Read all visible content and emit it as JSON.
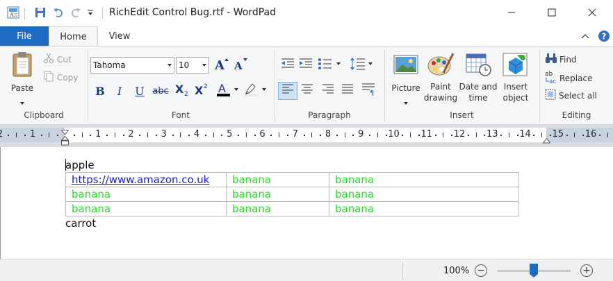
{
  "window": {
    "title": "RichEdit Control Bug.rtf - WordPad",
    "controls": [
      "minimize-icon",
      "maximize-icon",
      "close-icon"
    ]
  },
  "quick_access": [
    "save-icon",
    "undo-icon",
    "redo-icon",
    "customize-dropdown-icon"
  ],
  "ribbon": {
    "tabs": {
      "file": "File",
      "home": "Home",
      "view": "View"
    },
    "clipboard": {
      "label": "Clipboard",
      "paste": "Paste",
      "cut": "Cut",
      "copy": "Copy"
    },
    "font": {
      "label": "Font",
      "family": "Tahoma",
      "size": "10"
    },
    "paragraph": {
      "label": "Paragraph"
    },
    "insert": {
      "label": "Insert",
      "picture": "Picture",
      "paint_1": "Paint",
      "paint_2": "drawing",
      "date_1": "Date and",
      "date_2": "time",
      "object_1": "Insert",
      "object_2": "object"
    },
    "editing": {
      "label": "Editing",
      "find": "Find",
      "replace": "Replace",
      "select_all": "Select all"
    }
  },
  "ruler": {
    "left_numbers": [
      "2",
      "1"
    ],
    "numbers": [
      "1",
      "2",
      "3",
      "4",
      "5",
      "6",
      "7",
      "8",
      "9",
      "10",
      "11",
      "12",
      "13",
      "14",
      "15",
      "16"
    ]
  },
  "document": {
    "line1": "apple",
    "table": [
      [
        "https://www.amazon.co.uk",
        "banana",
        "banana"
      ],
      [
        "banana",
        "banana",
        "banana"
      ],
      [
        "banana",
        "banana",
        "banana"
      ]
    ],
    "line2": "carrot"
  },
  "status": {
    "zoom": "100%",
    "zoom_level_percent": 100
  },
  "colors": {
    "accent": "#1d6bc3",
    "link": "#1b1bc8",
    "green_text": "#22dd22"
  }
}
